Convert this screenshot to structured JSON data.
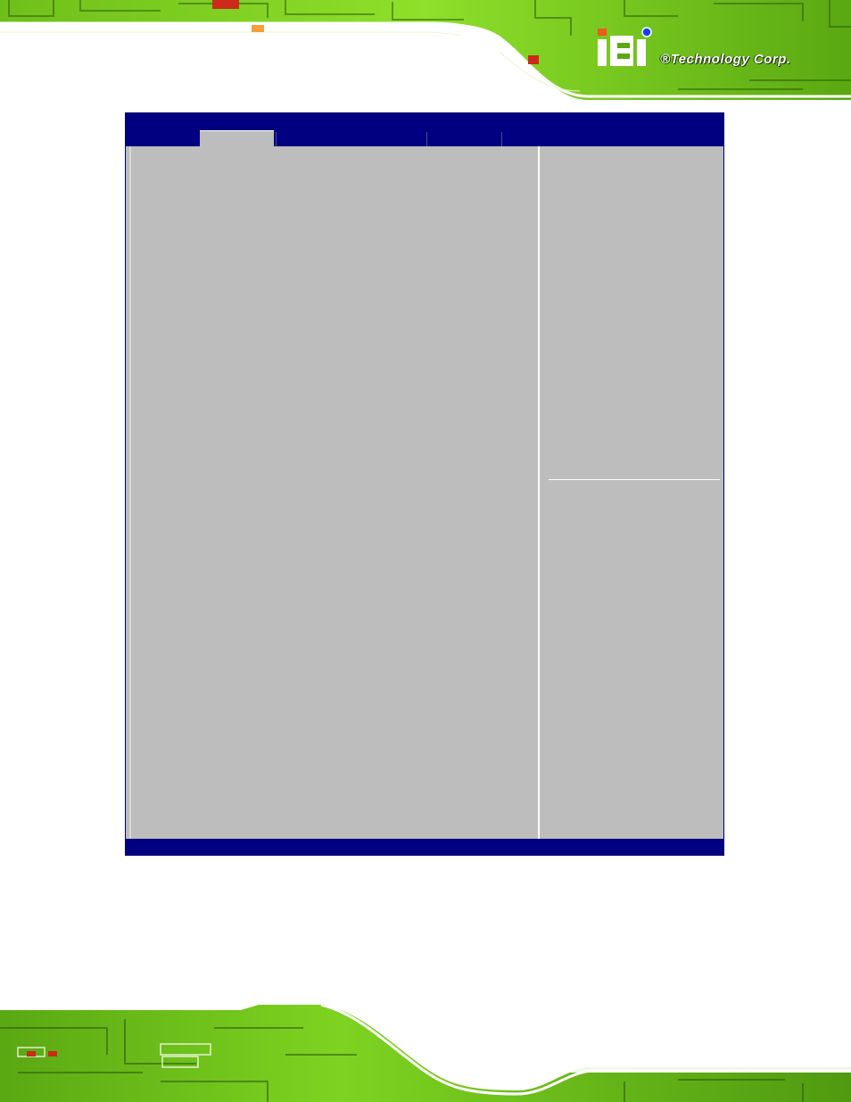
{
  "branding": {
    "company_name": "®Technology Corp.",
    "logo_letters": "iEi",
    "colors": {
      "circuit_green": "#7ed321",
      "circuit_dark": "#2f5f00",
      "brand_orange": "#f05a1a",
      "brand_blue": "#1a3cff"
    }
  },
  "bios_screen": {
    "title": "",
    "tabs": [
      {
        "label": ""
      },
      {
        "label": ""
      },
      {
        "label": ""
      },
      {
        "label": ""
      },
      {
        "label": ""
      }
    ],
    "active_tab_index": 1,
    "status_text": "",
    "colors": {
      "bar_blue": "#000080",
      "panel_gray": "#bdbdbd"
    }
  }
}
